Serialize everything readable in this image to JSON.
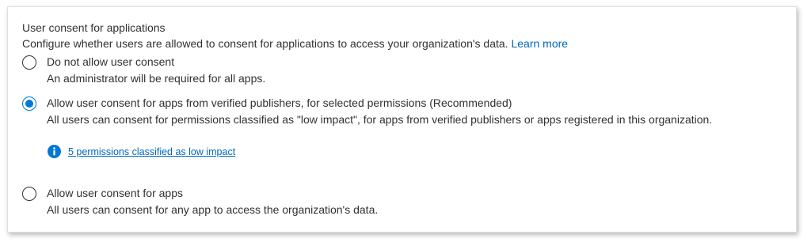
{
  "section": {
    "title": "User consent for applications",
    "description": "Configure whether users are allowed to consent for applications to access your organization's data.",
    "learn_more": "Learn more"
  },
  "options": [
    {
      "label": "Do not allow user consent",
      "description": "An administrator will be required for all apps.",
      "selected": false
    },
    {
      "label": "Allow user consent for apps from verified publishers, for selected permissions (Recommended)",
      "description": "All users can consent for permissions classified as \"low impact\", for apps from verified publishers or apps registered in this organization.",
      "selected": true
    },
    {
      "label": "Allow user consent for apps",
      "description": "All users can consent for any app to access the organization's data.",
      "selected": false
    }
  ],
  "info": {
    "icon": "info-icon",
    "link_text": "5 permissions classified as low impact"
  },
  "colors": {
    "accent": "#0078d4",
    "link": "#0067b8",
    "text": "#323130"
  }
}
